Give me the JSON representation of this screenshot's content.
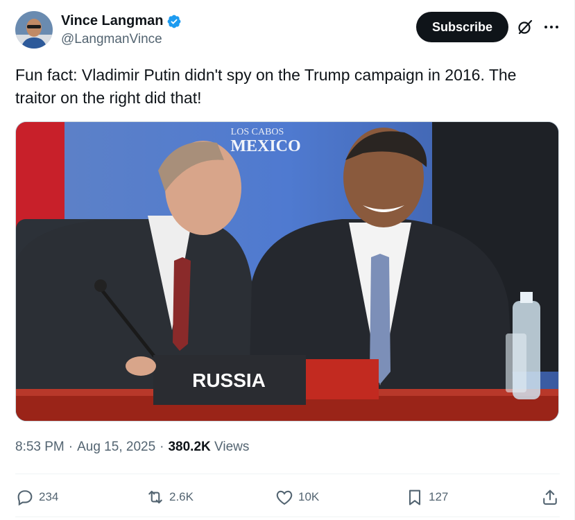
{
  "author": {
    "display_name": "Vince Langman",
    "handle": "@LangmanVince",
    "verified": true,
    "verified_color": "#1d9bf0"
  },
  "header": {
    "subscribe_label": "Subscribe"
  },
  "tweet": {
    "text": "Fun fact: Vladimir Putin didn't spy on the Trump campaign in 2016. The traitor on the right did that!"
  },
  "media": {
    "backdrop_text_top": "LOS CABOS",
    "backdrop_text_main": "MEXICO",
    "placard_text": "RUSSIA"
  },
  "meta": {
    "time": "8:53 PM",
    "date": "Aug 15, 2025",
    "separator": "·",
    "views_count": "380.2K",
    "views_label": "Views"
  },
  "actions": {
    "replies": "234",
    "reposts": "2.6K",
    "likes": "10K",
    "bookmarks": "127"
  },
  "colors": {
    "text_primary": "#0f1419",
    "text_secondary": "#536471",
    "subscribe_bg": "#0f1419"
  }
}
